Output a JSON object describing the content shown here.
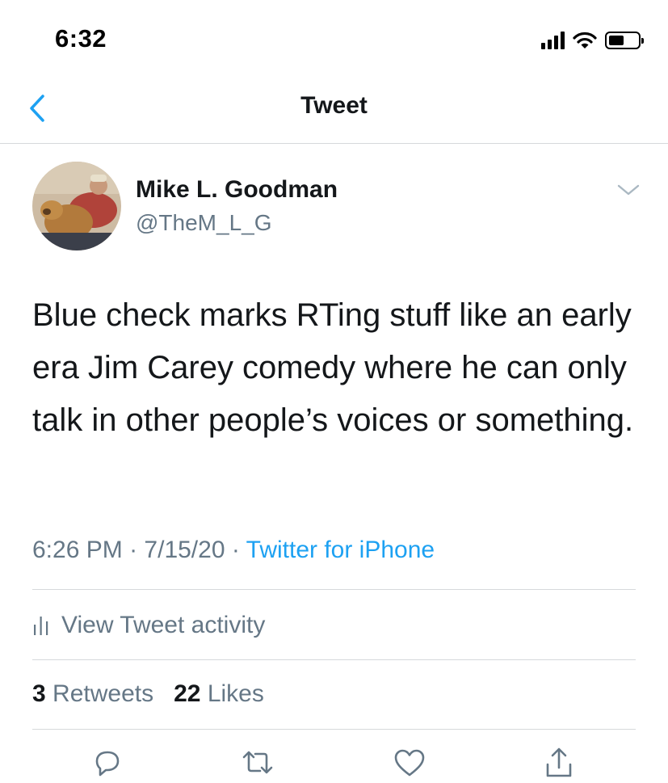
{
  "status_bar": {
    "time": "6:32"
  },
  "nav": {
    "title": "Tweet"
  },
  "tweet": {
    "author_name": "Mike L. Goodman",
    "author_handle": "@TheM_L_G",
    "text": "Blue check marks RTing stuff like an early era Jim Carey comedy where he can only talk in other people’s voices or something.",
    "time": "6:26 PM",
    "date": "7/15/20",
    "separator": "·",
    "source": "Twitter for iPhone"
  },
  "activity": {
    "label": "View Tweet activity"
  },
  "stats": {
    "retweets_count": "3",
    "retweets_label": "Retweets",
    "likes_count": "22",
    "likes_label": "Likes"
  },
  "icons": {
    "back": "chevron-left-icon",
    "more": "chevron-down-icon",
    "activity": "bar-chart-icon",
    "reply": "reply-icon",
    "retweet": "retweet-icon",
    "like": "heart-icon",
    "share": "share-icon"
  },
  "colors": {
    "accent": "#1da1f2",
    "secondary_text": "#657786",
    "primary_text": "#14171a",
    "divider": "#d6d9db"
  }
}
